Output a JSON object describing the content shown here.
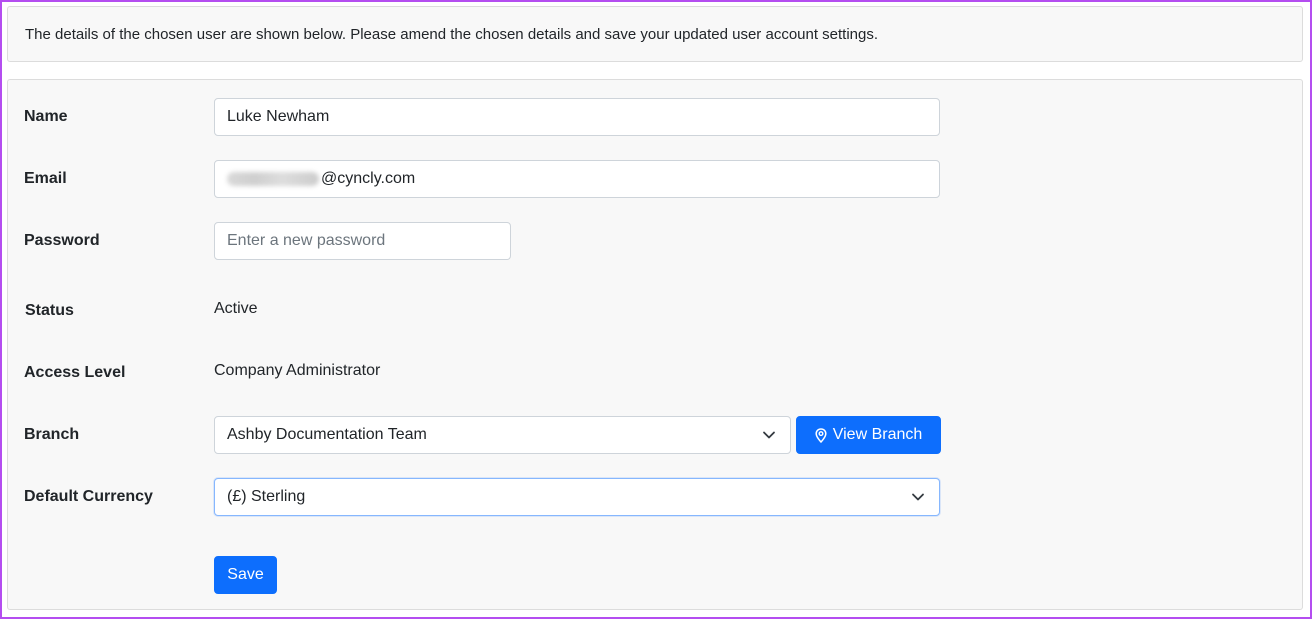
{
  "intro": {
    "text": "The details of the chosen user are shown below. Please amend the chosen details and save your updated user account settings."
  },
  "form": {
    "name": {
      "label": "Name",
      "value": "Luke Newham"
    },
    "email": {
      "label": "Email",
      "value_suffix": "@cyncly.com"
    },
    "password": {
      "label": "Password",
      "value": "",
      "placeholder": "Enter a new password"
    },
    "status": {
      "label": "Status",
      "value": "Active"
    },
    "access_level": {
      "label": "Access Level",
      "value": "Company Administrator"
    },
    "branch": {
      "label": "Branch",
      "selected": "Ashby Documentation Team",
      "view_button_label": "View Branch",
      "view_button_icon": "map-pin-icon"
    },
    "default_currency": {
      "label": "Default Currency",
      "selected": "(£) Sterling"
    },
    "save_label": "Save"
  },
  "colors": {
    "primary": "#0d6efd",
    "frame_border": "#b44df0",
    "panel_background": "#f8f8f8"
  }
}
